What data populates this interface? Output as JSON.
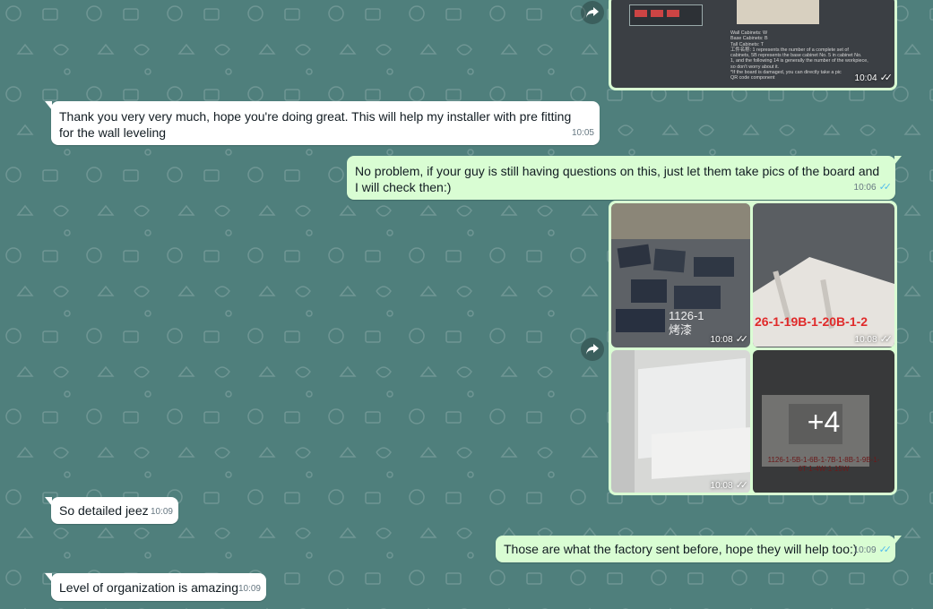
{
  "colors": {
    "background": "#4f7f7c",
    "incoming": "#ffffff",
    "outgoing": "#d9fdd3",
    "read_ticks": "#53bdeb"
  },
  "top_image": {
    "lines": [
      "Wall Cabinets:   W",
      "Base Cabinets:   B",
      "Tall  Cabinets:   T",
      "工件名称: 1 represents the number of a complete set of",
      "cabinets, 5B represents the base cabinet No. 5 in cabinet No.",
      "1, and the following 14 is generally the number of the workpiece,",
      "so don't worry about it.",
      "*If the board is damaged, you can directly take a pic",
      "QR code component"
    ],
    "time": "10:04"
  },
  "messages": [
    {
      "text": "Thank you very very much, hope you're doing great. This will help my installer with pre fitting for the wall leveling",
      "time": "10:05"
    },
    {
      "text": "No problem, if your guy is still having questions on this, just let them take pics of the board and I will check then:)",
      "time": "10:06"
    },
    {
      "text": "So detailed jeez",
      "time": "10:09"
    },
    {
      "text": "Those are what the factory sent before, hope they will help too:)",
      "time": "10:09"
    },
    {
      "text": "Level of organization is amazing",
      "time": "10:09"
    }
  ],
  "album": {
    "tiles": [
      {
        "label": "1126-1\n烤漆",
        "time": "10:08"
      },
      {
        "label": "26-1-19B-1-20B-1-2",
        "time": "10:08"
      },
      {
        "label": "",
        "time": "10:08"
      },
      {
        "label": "1126-1-5B-1-6B-1-7B-1-8B-1-9B-1-\n6T-1-4W-1-15W",
        "more": "+4"
      }
    ]
  },
  "ticks": "✓✓"
}
